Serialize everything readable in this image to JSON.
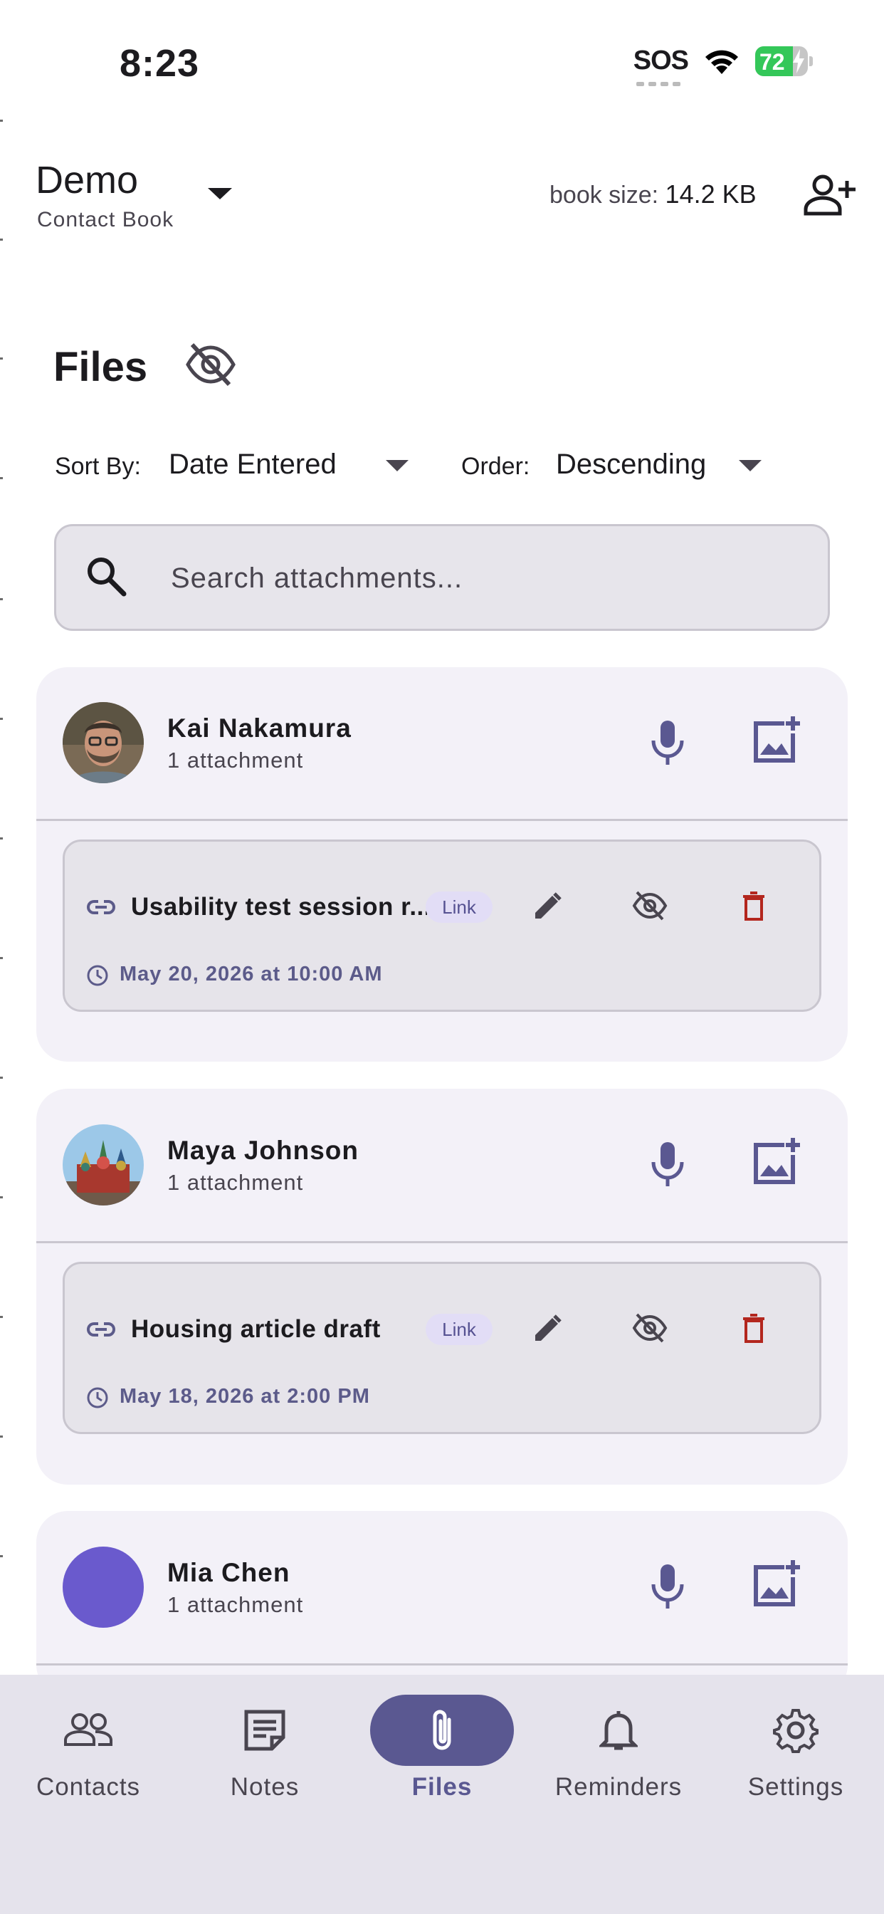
{
  "status_bar": {
    "time": "8:23",
    "sos": "SOS",
    "battery": "72"
  },
  "header": {
    "book_name": "Demo",
    "book_subtitle": "Contact Book",
    "size_label": "book size:",
    "size_value": "14.2 KB"
  },
  "page": {
    "title": "Files"
  },
  "sort": {
    "sort_label": "Sort By:",
    "sort_value": "Date Entered",
    "order_label": "Order:",
    "order_value": "Descending"
  },
  "search": {
    "placeholder": "Search attachments..."
  },
  "contacts": [
    {
      "name": "Kai Nakamura",
      "count": "1 attachment",
      "attachment": {
        "title": "Usability test session r...",
        "type": "Link",
        "date": "May 20, 2026 at 10:00 AM"
      }
    },
    {
      "name": "Maya Johnson",
      "count": "1 attachment",
      "attachment": {
        "title": "Housing article draft",
        "type": "Link",
        "date": "May 18, 2026 at 2:00 PM"
      }
    },
    {
      "name": "Mia Chen",
      "count": "1 attachment"
    }
  ],
  "nav": {
    "items": [
      {
        "label": "Contacts",
        "icon": "contacts-icon"
      },
      {
        "label": "Notes",
        "icon": "notes-icon"
      },
      {
        "label": "Files",
        "icon": "paperclip-icon",
        "active": true
      },
      {
        "label": "Reminders",
        "icon": "bell-icon"
      },
      {
        "label": "Settings",
        "icon": "gear-icon"
      }
    ]
  },
  "colors": {
    "accent": "#5a5891",
    "card_bg": "#f3f1f8",
    "attachment_bg": "#e6e4ea",
    "chip_bg": "#e2ddf6",
    "delete": "#b3261e",
    "nav_bg": "#e5e3ec",
    "mia_avatar": "#6a5acd"
  }
}
